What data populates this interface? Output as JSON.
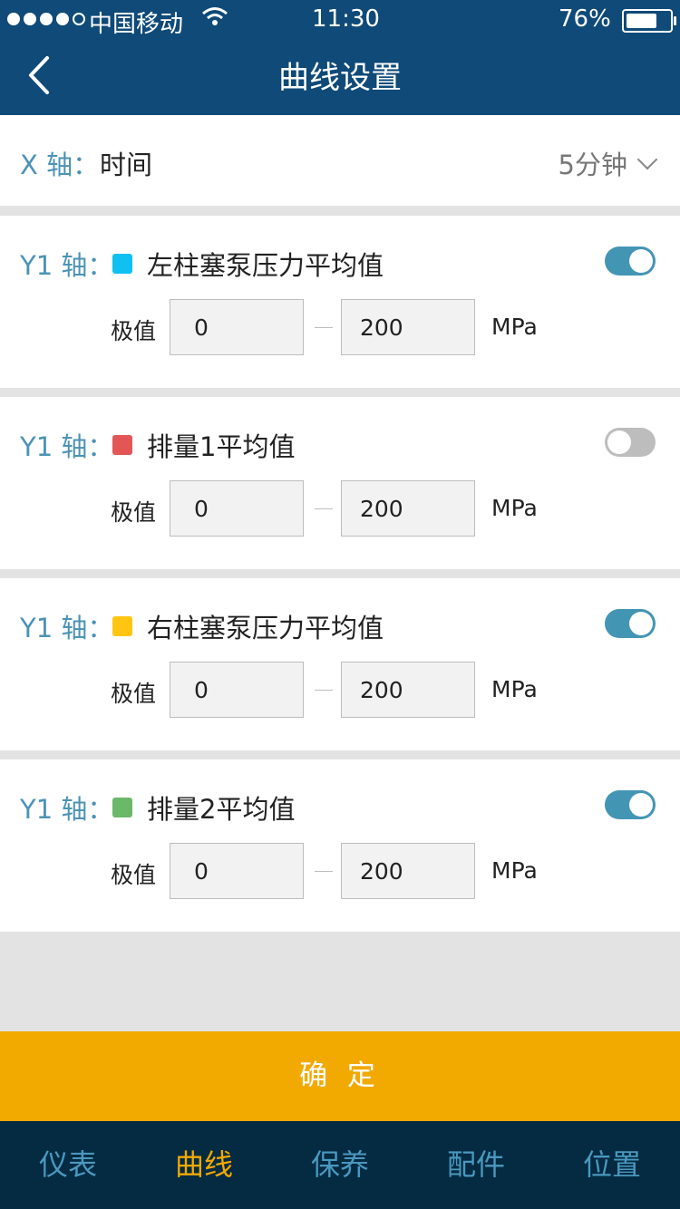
{
  "status_bar": {
    "carrier": "中国移动",
    "time": "11:30",
    "battery_percent": "76%",
    "battery_level": 0.76
  },
  "header": {
    "title": "曲线设置"
  },
  "x_axis": {
    "label": "X 轴：",
    "name": "时间",
    "interval": "5分钟"
  },
  "series": [
    {
      "axis_label": "Y1 轴：",
      "color": "#10c0f0",
      "name": "左柱塞泵压力平均值",
      "enabled": true,
      "range_label": "极值",
      "min": "0",
      "max": "200",
      "unit": "MPa"
    },
    {
      "axis_label": "Y1 轴：",
      "color": "#e35656",
      "name": "排量1平均值",
      "enabled": false,
      "range_label": "极值",
      "min": "0",
      "max": "200",
      "unit": "MPa"
    },
    {
      "axis_label": "Y1 轴：",
      "color": "#ffc510",
      "name": "右柱塞泵压力平均值",
      "enabled": true,
      "range_label": "极值",
      "min": "0",
      "max": "200",
      "unit": "MPa"
    },
    {
      "axis_label": "Y1 轴：",
      "color": "#6cb86a",
      "name": "排量2平均值",
      "enabled": true,
      "range_label": "极值",
      "min": "0",
      "max": "200",
      "unit": "MPa"
    }
  ],
  "confirm_label": "确 定",
  "tabs": [
    {
      "label": "仪表",
      "active": false
    },
    {
      "label": "曲线",
      "active": true
    },
    {
      "label": "保养",
      "active": false
    },
    {
      "label": "配件",
      "active": false
    },
    {
      "label": "位置",
      "active": false
    }
  ],
  "colors": {
    "header": "#0f4a78",
    "accent": "#f2a900",
    "tabbar": "#042b42",
    "axis_label": "#4b93b6",
    "toggle_on": "#4395b4"
  }
}
